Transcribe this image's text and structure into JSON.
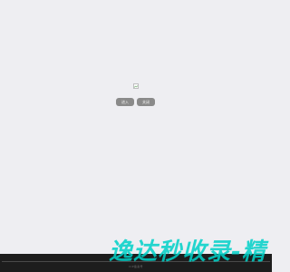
{
  "toolbar": {
    "enter_label": "进入",
    "close_label": "关闭"
  },
  "footer": {
    "text": "ICP备案号"
  },
  "watermark": {
    "text": "逸达秒收录-精"
  },
  "colors": {
    "background": "#eeeef2",
    "button_bg": "#8a8a8a",
    "footer_bg": "#1d1d1d",
    "watermark": "#00d1c8"
  }
}
